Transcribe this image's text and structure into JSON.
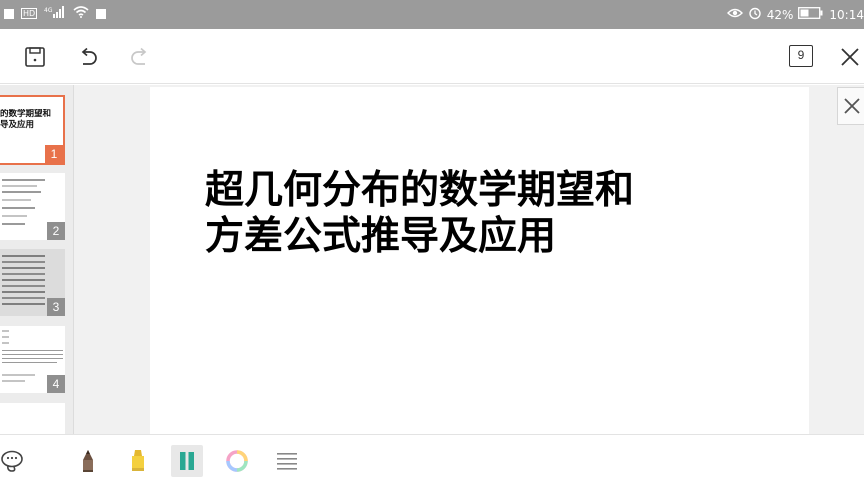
{
  "status_bar": {
    "hd_label": "HD",
    "network_label": "4G",
    "battery_text": "42%",
    "time_text": "10:14",
    "icons": [
      "notification-square-icon",
      "hd-icon",
      "signal-icon",
      "wifi-icon",
      "notification-square-icon",
      "eye-icon",
      "alarm-icon",
      "battery-icon"
    ]
  },
  "toolbar": {
    "icons": [
      "save-icon",
      "undo-icon",
      "redo-icon",
      "slide-count-icon",
      "close-icon"
    ],
    "page_count": "9"
  },
  "thumbnails": [
    {
      "number": "1",
      "title_lines": [
        "的数学期望和",
        "导及应用"
      ],
      "active": true
    },
    {
      "number": "2",
      "title_lines": [],
      "active": false
    },
    {
      "number": "3",
      "title_lines": [],
      "active": false
    },
    {
      "number": "4",
      "title_lines": [],
      "active": false
    }
  ],
  "slide": {
    "title_line1": "超几何分布的数学期望和",
    "title_line2": "方差公式推导及应用"
  },
  "bottom_toolbar": {
    "icons": [
      "lasso-icon",
      "pen-icon",
      "highlighter-icon",
      "eraser-icon",
      "color-ring-icon",
      "menu-lines-icon"
    ],
    "colors": {
      "pen": "#8a6d5a",
      "highlighter": "#f4d03f",
      "eraser": "#2aa893",
      "accent": "#e8714a"
    }
  }
}
